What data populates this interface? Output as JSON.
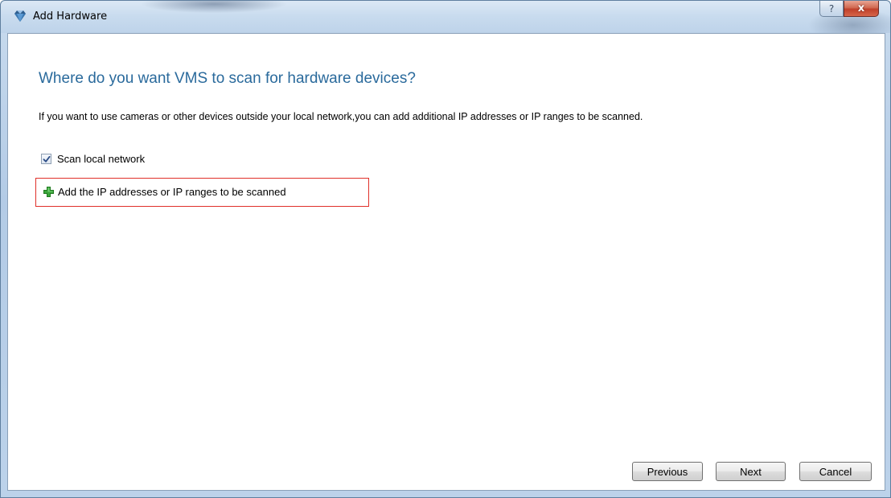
{
  "window": {
    "title": "Add Hardware",
    "help_label": "?",
    "close_label": "x"
  },
  "main": {
    "heading": "Where do you want VMS to scan for hardware devices?",
    "description": "If you want to use cameras or other devices outside your local network,you can add additional IP addresses or IP ranges to be scanned.",
    "scan_local": {
      "label": "Scan local network",
      "checked": true
    },
    "add_ip_label": "Add the IP addresses or IP ranges to be scanned"
  },
  "footer": {
    "previous_label": "Previous",
    "next_label": "Next",
    "cancel_label": "Cancel"
  },
  "icons": {
    "app": "gem-app-icon",
    "help": "help-icon",
    "close": "close-icon",
    "check": "checkmark-icon",
    "add": "plus-icon"
  },
  "colors": {
    "heading": "#2a6a9c",
    "highlight_border": "#e0302a",
    "plus_icon": "#3aa53a",
    "close_button": "#c0402a"
  }
}
